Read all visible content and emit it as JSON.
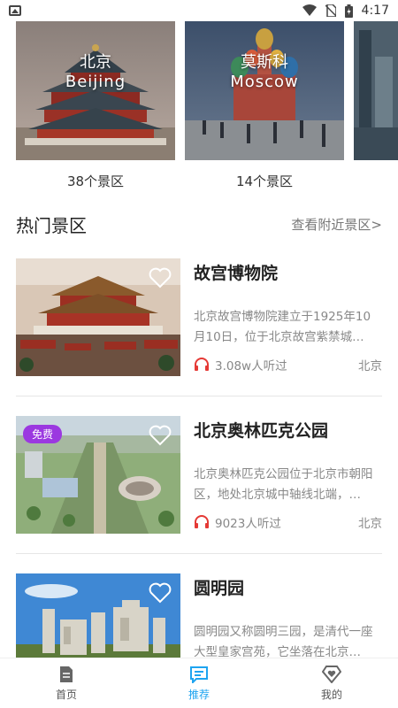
{
  "status_bar": {
    "time": "4:17",
    "icons": [
      "gallery-icon",
      "wifi-icon",
      "no-sim-icon",
      "battery-icon"
    ]
  },
  "cities": [
    {
      "name_cn": "北京",
      "name_en": "Beijing",
      "count": "38个景区"
    },
    {
      "name_cn": "莫斯科",
      "name_en": "Moscow",
      "count": "14个景区"
    }
  ],
  "section": {
    "title": "热门景区",
    "more_link": "查看附近景区>"
  },
  "attractions": [
    {
      "title": "故宫博物院",
      "badge": "",
      "description": "北京故宫博物院建立于1925年10月10日，位于北京故宫紫禁城…",
      "listeners": "3.08w人听过",
      "city": "北京"
    },
    {
      "title": "北京奥林匹克公园",
      "badge": "免费",
      "description": "北京奥林匹克公园位于北京市朝阳区，地处北京城中轴线北端，…",
      "listeners": "9023人听过",
      "city": "北京"
    },
    {
      "title": "圆明园",
      "badge": "",
      "description": "圆明园又称圆明三园，是清代一座大型皇家宫苑，它坐落在北京…",
      "listeners": "",
      "city": ""
    }
  ],
  "bottom_nav": [
    {
      "label": "首页",
      "icon": "document-icon",
      "active": false
    },
    {
      "label": "推荐",
      "icon": "recommend-icon",
      "active": true
    },
    {
      "label": "我的",
      "icon": "diamond-heart-icon",
      "active": false
    }
  ],
  "colors": {
    "accent": "#1ea4f0",
    "badge": "#9b38e0",
    "headphone": "#e53935"
  }
}
